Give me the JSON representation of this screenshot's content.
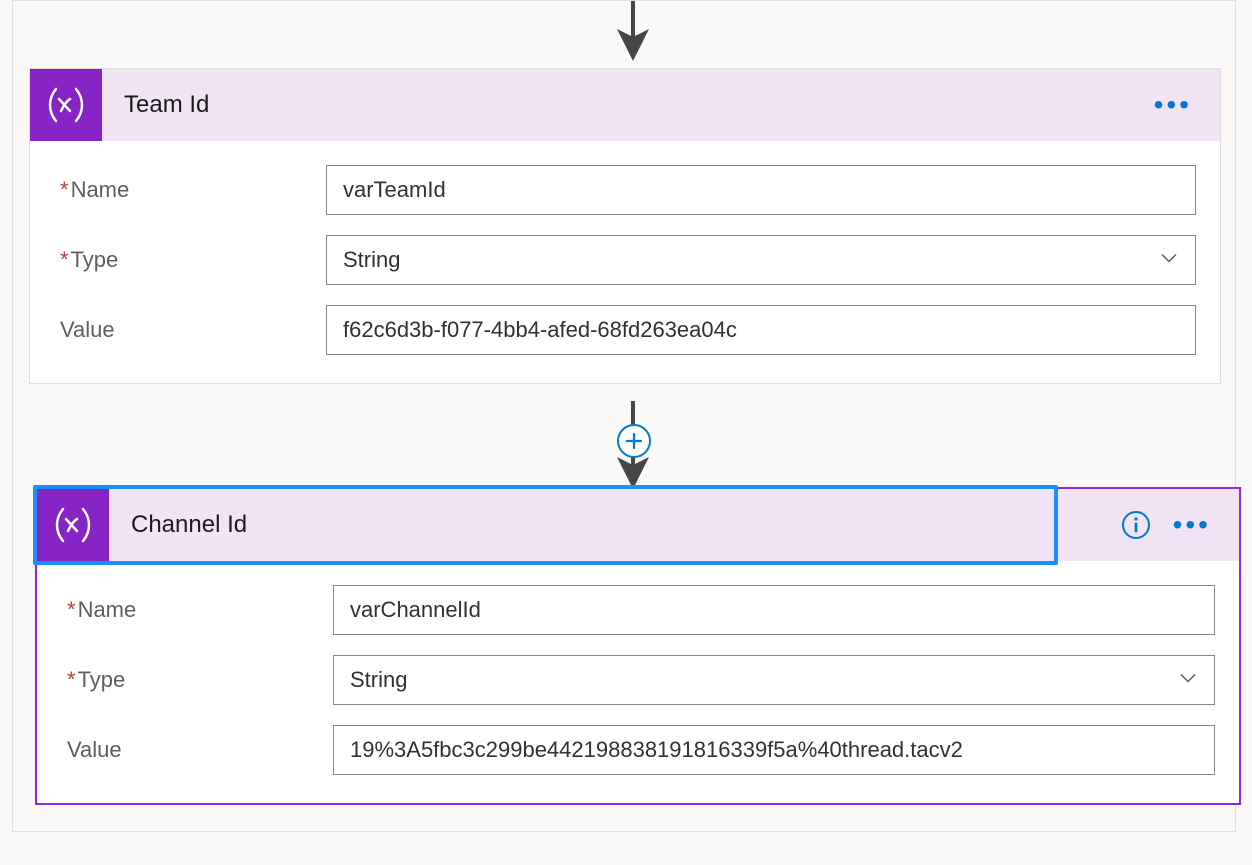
{
  "labels": {
    "name": "Name",
    "type": "Type",
    "value": "Value"
  },
  "cards": [
    {
      "title": "Team Id",
      "name_value": "varTeamId",
      "type_value": "String",
      "value_value": "f62c6d3b-f077-4bb4-afed-68fd263ea04c",
      "selected": false,
      "show_info": false
    },
    {
      "title": "Channel Id",
      "name_value": "varChannelId",
      "type_value": "String",
      "value_value": "19%3A5fbc3c299be442198838191816339f5a%40thread.tacv2",
      "selected": true,
      "show_info": true
    }
  ]
}
